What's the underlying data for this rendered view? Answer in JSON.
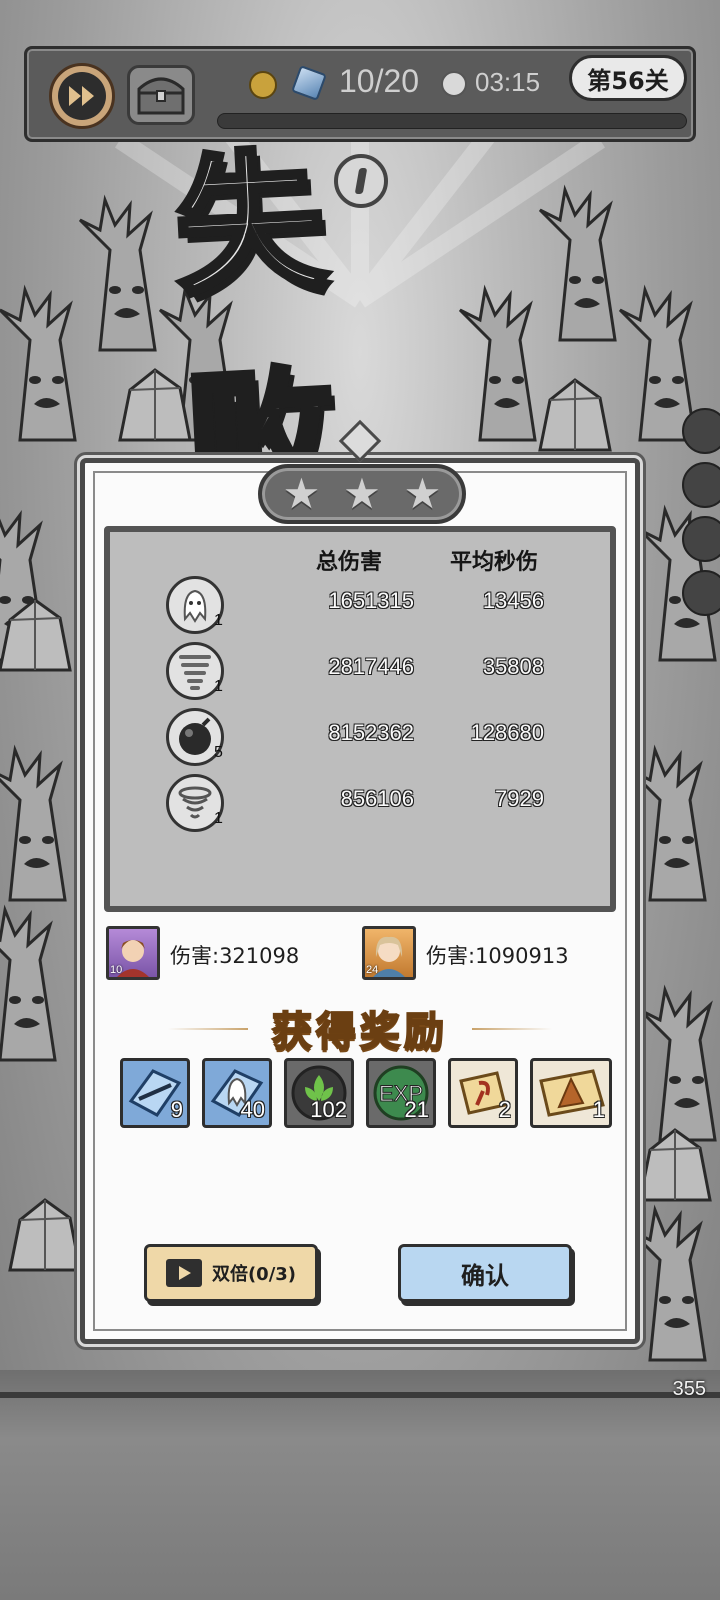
{
  "hud": {
    "wave": "10/20",
    "timer": "03:15",
    "level": "第56关",
    "icons": [
      "fast-forward-icon",
      "chest-icon",
      "coin-icon",
      "gem-icon",
      "clock-icon",
      "pause-icon"
    ]
  },
  "result": {
    "title": "失 败",
    "stars": 0,
    "stats_headers": {
      "total": "总伤害",
      "dps": "平均秒伤"
    },
    "skills": [
      {
        "icon": "ghost-skill-icon",
        "level": "1",
        "total": "1651315",
        "dps": "13456"
      },
      {
        "icon": "tornado-skill-icon",
        "level": "1",
        "total": "2817446",
        "dps": "35808"
      },
      {
        "icon": "bomb-skill-icon",
        "level": "5",
        "total": "8152362",
        "dps": "128680"
      },
      {
        "icon": "whirlwind-skill-icon",
        "level": "1",
        "total": "856106",
        "dps": "7929"
      }
    ],
    "heroes": [
      {
        "level": "10",
        "damage": "伤害:321098"
      },
      {
        "level": "24",
        "damage": "伤害:1090913"
      }
    ]
  },
  "rewards": {
    "title": "获得奖励",
    "items": [
      {
        "icon": "blue-crystal-shard-icon",
        "count": "9"
      },
      {
        "icon": "ghost-crystal-icon",
        "count": "40"
      },
      {
        "icon": "green-leaf-emblem-icon",
        "count": "102"
      },
      {
        "icon": "exp-orb-icon",
        "count": "21"
      },
      {
        "icon": "scroll-icon",
        "count": "2"
      },
      {
        "icon": "cloak-scroll-icon",
        "count": "1"
      }
    ],
    "exp_label": "EXP"
  },
  "buttons": {
    "double": "双倍(0/3)",
    "confirm": "确认"
  },
  "scene": {
    "corner_number": "355"
  },
  "colors": {
    "panel": "#fbfbfb",
    "double_button": "#efd8a8",
    "confirm_button": "#b9d7f1",
    "reward_title": "#f1d38a"
  }
}
